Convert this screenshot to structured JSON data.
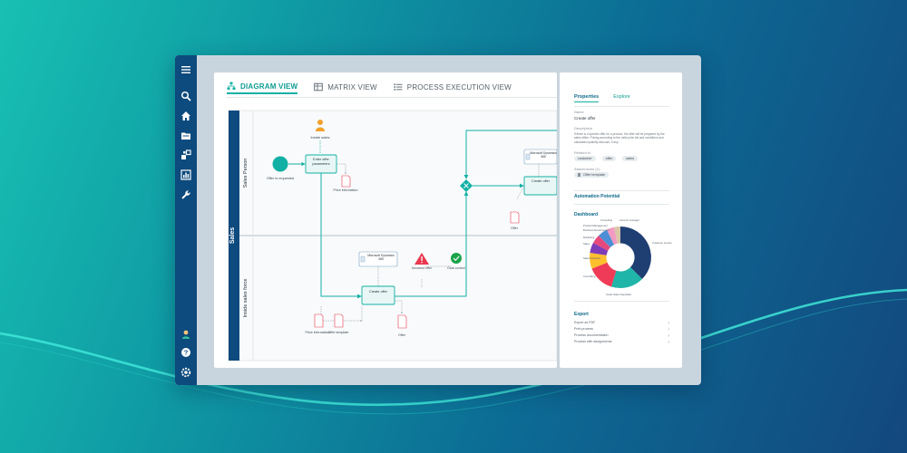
{
  "sidebar": {
    "icons": [
      "menu-icon",
      "search-icon",
      "home-icon",
      "folder-icon",
      "process-icon",
      "chart-icon",
      "wrench-icon",
      "avatar",
      "help-icon",
      "settings-icon"
    ]
  },
  "tabs": [
    {
      "label": "DIAGRAM VIEW",
      "icon": "diagram-icon",
      "active": true
    },
    {
      "label": "MATRIX VIEW",
      "icon": "matrix-icon",
      "active": false
    },
    {
      "label": "PROCESS EXECUTION VIEW",
      "icon": "list-icon",
      "active": false
    }
  ],
  "diagram": {
    "pool": "Sales",
    "lanes": [
      "Sales Person",
      "Inside sales force"
    ],
    "role": "Inside sales",
    "start_event": "Offer is requested",
    "tasks": {
      "enter_params": "Enter offer parameters",
      "create_offer_1": "Create offer",
      "create_offer_2": "Create offer"
    },
    "systems": {
      "ms_dynamics_1": "Microsoft Dynamics 365",
      "ms_dynamics_2": "Microsoft Dynamics 365"
    },
    "documents": {
      "price_info_1": "Price information",
      "offer_top": "Offer",
      "price_info_2": "Price information",
      "offer_template": "Offer template",
      "offer_bottom": "Offer"
    },
    "risk": "Incorrect offer",
    "control": "Dual control"
  },
  "properties": {
    "tabs": [
      "Properties",
      "Explore"
    ],
    "name_label": "Name",
    "name_value": "Create offer",
    "description_label": "Description",
    "description": "If there is a specific offer for a product, the offer will be prepared by the sales office. Pricing according to the valid price list and conditions and calculated quantity discount, if any.",
    "related_label": "Related to",
    "chips": [
      "customer",
      "offer",
      "sales"
    ],
    "attachments_label": "Attachments (1)",
    "attachment": "Offer template",
    "automation": "Automation Potential",
    "dashboard": "Dashboard",
    "donut_labels": [
      "Consulting",
      "Account manager",
      "Product Management",
      "Business Development",
      "Marketing",
      "Sales",
      "Sales Assistant",
      "Controlling",
      "Inside Sales Specialist",
      "Customer service"
    ],
    "export": "Export",
    "export_items": [
      "Export as PDF",
      "Print process",
      "Process documentation",
      "Process with assignments"
    ]
  },
  "colors": {
    "accent": "#12b0a4",
    "sidebar": "#0d4a7d",
    "risk": "#e8384f",
    "control": "#1aa34a"
  }
}
